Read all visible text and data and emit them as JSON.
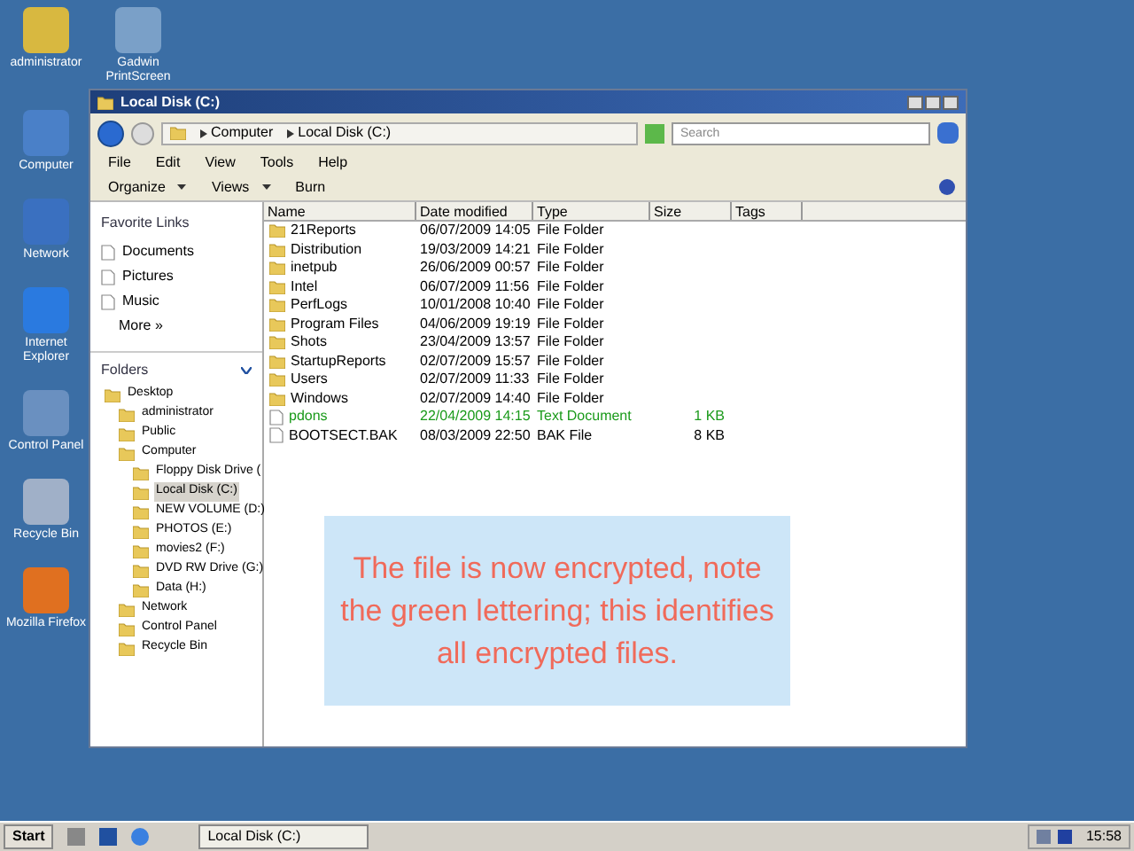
{
  "desktop_icons": [
    {
      "label": "administrator"
    },
    {
      "label": "Gadwin PrintScreen"
    },
    {
      "label": "Computer"
    },
    {
      "label": "Network"
    },
    {
      "label": "Internet Explorer"
    },
    {
      "label": "Control Panel"
    },
    {
      "label": "Recycle Bin"
    },
    {
      "label": "Mozilla Firefox"
    }
  ],
  "window": {
    "title": "Local Disk (C:)",
    "breadcrumb": [
      "Computer",
      "Local Disk (C:)"
    ],
    "search": {
      "placeholder": "Search"
    },
    "menu": [
      "File",
      "Edit",
      "View",
      "Tools",
      "Help"
    ],
    "toolbar": [
      "Organize",
      "Views",
      "Burn"
    ],
    "favorite_links": {
      "title": "Favorite Links",
      "items": [
        "Documents",
        "Pictures",
        "Music"
      ],
      "more": "More »"
    },
    "folders": {
      "title": "Folders",
      "expanded": true,
      "tree": [
        {
          "label": "Desktop",
          "selected": false,
          "children": [
            {
              "label": "administrator",
              "selected": false
            },
            {
              "label": "Public",
              "selected": false
            },
            {
              "label": "Computer",
              "selected": false,
              "children": [
                {
                  "label": "Floppy Disk Drive (",
                  "selected": false
                },
                {
                  "label": "Local Disk (C:)",
                  "selected": true
                },
                {
                  "label": "NEW VOLUME (D:)",
                  "selected": false
                },
                {
                  "label": "PHOTOS (E:)",
                  "selected": false
                },
                {
                  "label": "movies2 (F:)",
                  "selected": false
                },
                {
                  "label": "DVD RW Drive (G:)",
                  "selected": false
                },
                {
                  "label": "Data (H:)",
                  "selected": false
                }
              ]
            },
            {
              "label": "Network",
              "selected": false
            },
            {
              "label": "Control Panel",
              "selected": false
            },
            {
              "label": "Recycle Bin",
              "selected": false
            }
          ]
        }
      ]
    },
    "columns": [
      "Name",
      "Date modified",
      "Type",
      "Size",
      "Tags"
    ],
    "files": [
      {
        "kind": "folder",
        "name": "21Reports",
        "date": "06/07/2009 14:05",
        "type": "File Folder",
        "encrypted": false
      },
      {
        "kind": "folder",
        "name": "Distribution",
        "date": "19/03/2009 14:21",
        "type": "File Folder",
        "encrypted": false
      },
      {
        "kind": "folder",
        "name": "inetpub",
        "date": "26/06/2009 00:57",
        "type": "File Folder",
        "encrypted": false
      },
      {
        "kind": "folder",
        "name": "Intel",
        "date": "06/07/2009 11:56",
        "type": "File Folder",
        "encrypted": false
      },
      {
        "kind": "folder",
        "name": "PerfLogs",
        "date": "10/01/2008 10:40",
        "type": "File Folder",
        "encrypted": false
      },
      {
        "kind": "folder",
        "name": "Program Files",
        "date": "04/06/2009 19:19",
        "type": "File Folder",
        "encrypted": false
      },
      {
        "kind": "folder",
        "name": "Shots",
        "date": "23/04/2009 13:57",
        "type": "File Folder",
        "encrypted": false
      },
      {
        "kind": "folder",
        "name": "StartupReports",
        "date": "02/07/2009 15:57",
        "type": "File Folder",
        "encrypted": false
      },
      {
        "kind": "folder",
        "name": "Users",
        "date": "02/07/2009 11:33",
        "type": "File Folder",
        "encrypted": false
      },
      {
        "kind": "folder",
        "name": "Windows",
        "date": "02/07/2009 14:40",
        "type": "File Folder",
        "encrypted": false
      },
      {
        "kind": "file",
        "name": "pdons",
        "date": "22/04/2009 14:15",
        "type": "Text Document",
        "size": "1 KB",
        "encrypted": true
      },
      {
        "kind": "file",
        "name": "BOOTSECT.BAK",
        "date": "08/03/2009 22:50",
        "type": "BAK File",
        "size": "8 KB",
        "encrypted": false
      }
    ]
  },
  "caption": "The file is now encrypted, note the green lettering; this identifies all encrypted files.",
  "taskbar": {
    "start": "Start",
    "task": "Local Disk (C:)",
    "clock": "15:58"
  }
}
